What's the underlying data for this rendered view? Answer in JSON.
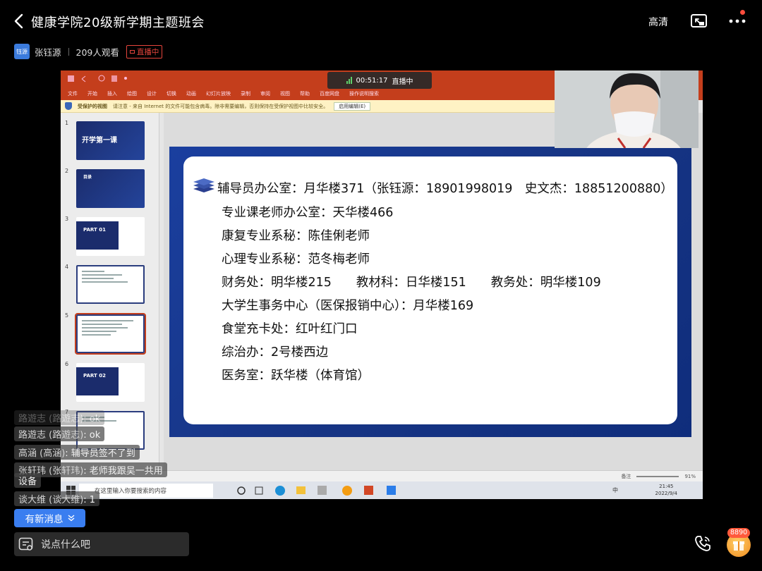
{
  "header": {
    "title": "健康学院20级新学期主题班会",
    "quality_label": "高清"
  },
  "host": {
    "avatar_text": "钰源",
    "name": "张钰源",
    "viewers": "209人观看",
    "live_label": "直播中"
  },
  "screen": {
    "timer": "00:51:17",
    "timer_status": "直播中",
    "ribbon_tabs": [
      "文件",
      "开始",
      "插入",
      "绘图",
      "设计",
      "切换",
      "动画",
      "幻灯片放映",
      "录制",
      "审阅",
      "视图",
      "帮助",
      "百度网盘",
      "操作说明搜索"
    ],
    "warning_title": "受保护的视图",
    "warning_text": "请注意 - 来自 Internet 的文件可能包含病毒。除非需要编辑，否则保持在受保护视图中比较安全。",
    "warning_button": "启用编辑(E)",
    "thumbnails": [
      {
        "num": "1",
        "text": "开学第一课"
      },
      {
        "num": "2",
        "text": "目录"
      },
      {
        "num": "3",
        "text": "PART 01"
      },
      {
        "num": "4",
        "text": ""
      },
      {
        "num": "5",
        "text": ""
      },
      {
        "num": "6",
        "text": "PART 02"
      },
      {
        "num": "7",
        "text": ""
      }
    ],
    "slide_lines": [
      "辅导员办公室：月华楼371（张钰源：18901998019　史文杰：18851200880）",
      "专业课老师办公室：天华楼466",
      "康复专业系秘：陈佳俐老师",
      "心理专业系秘：范冬梅老师",
      "财务处：明华楼215　　教材科：日华楼151　　教务处：明华楼109",
      "大学生事务中心（医保报销中心）：月华楼169",
      "食堂充卡处：红叶红门口",
      "综治办：2号楼西边",
      "医务室：跃华楼（体育馆）"
    ],
    "status_notes": "备注",
    "status_zoom": "91%",
    "taskbar_search": "在这里输入你要搜索的内容",
    "taskbar_time": "21:45",
    "taskbar_date": "2022/9/4",
    "taskbar_ime": "中"
  },
  "chat": [
    {
      "name": "路遊志 (路遊志)",
      "text": "ok",
      "faded": true
    },
    {
      "name": "路遊志 (路遊志)",
      "text": "ok",
      "faded": false
    },
    {
      "name": "高涵 (高涵)",
      "text": "辅导员签不了到",
      "faded": false
    },
    {
      "name": "张轩玮 (张轩玮)",
      "text": "老师我跟吴一共用",
      "faded": false
    },
    {
      "name": "",
      "text": "设备",
      "faded": false
    },
    {
      "name": "谈大维 (谈大维)",
      "text": "1",
      "faded": false
    }
  ],
  "footer": {
    "new_messages": "有新消息",
    "input_placeholder": "说点什么吧",
    "gift_count": "8890"
  },
  "colors": {
    "accent": "#3a7ef0",
    "live_red": "#e5453c",
    "ppt_ribbon": "#c43e1c",
    "slide_blue": "#173585"
  }
}
